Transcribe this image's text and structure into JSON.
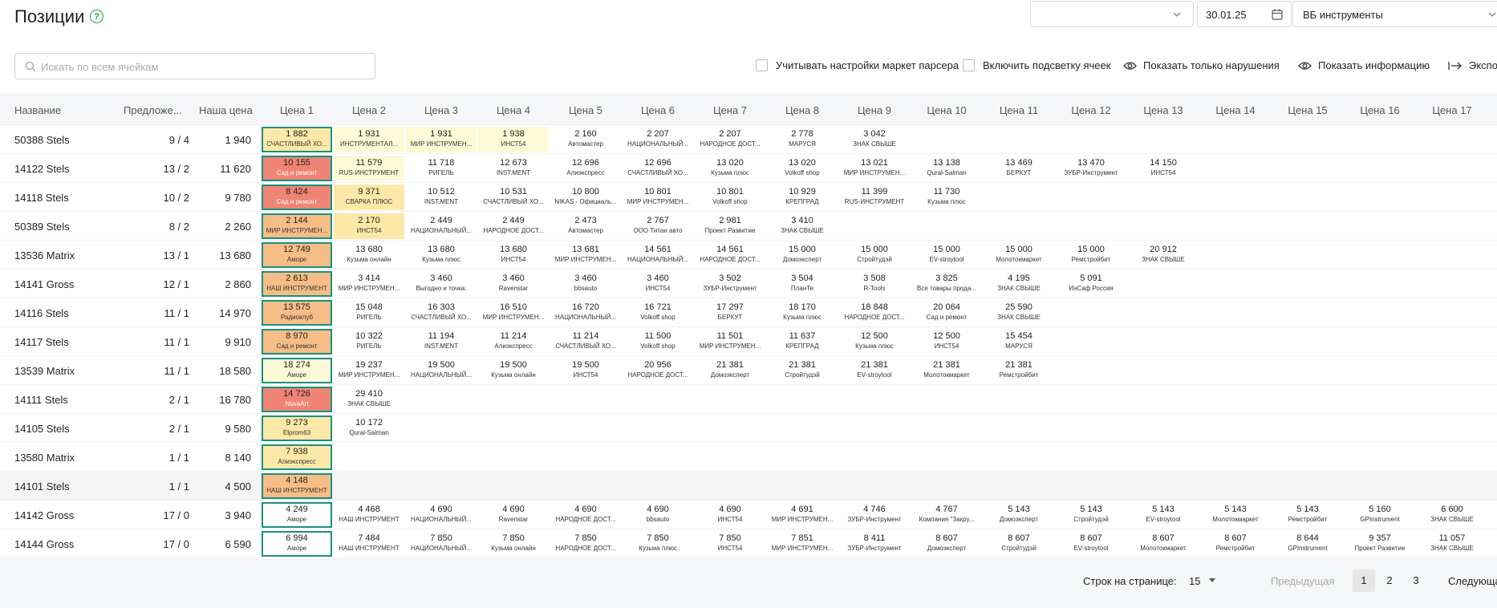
{
  "header": {
    "title": "Позиции",
    "help_icon": "question-circle-icon",
    "filter1_value": "",
    "date": "30.01.25",
    "marketplace": "ВБ инструменты"
  },
  "search": {
    "placeholder": "Искать по всем ячейкам",
    "value": ""
  },
  "options": {
    "parser_settings": "Учитывать настройки маркет парсера",
    "highlight_cells": "Включить подсветку ячеек",
    "only_violations": "Показать только нарушения",
    "show_info": "Показать информацию",
    "export": "Экспо"
  },
  "columns": {
    "name": "Название",
    "offers": "Предложе...",
    "our_price": "Наша цена",
    "prices": [
      "Цена 1",
      "Цена 2",
      "Цена 3",
      "Цена 4",
      "Цена 5",
      "Цена 6",
      "Цена 7",
      "Цена 8",
      "Цена 9",
      "Цена 10",
      "Цена 11",
      "Цена 12",
      "Цена 13",
      "Цена 14",
      "Цена 15",
      "Цена 16",
      "Цена 17"
    ]
  },
  "rows": [
    {
      "name": "50388 Stels",
      "offers": "9 / 4",
      "ours": "1 940",
      "prices": [
        [
          "1 882",
          "СЧАСТЛИВЫЙ ХО...",
          "yellow"
        ],
        [
          "1 931",
          "ИНСТРУМЕНТАЛ...",
          "lyellow"
        ],
        [
          "1 931",
          "МИР ИНСТРУМЕН...",
          "lyellow"
        ],
        [
          "1 938",
          "ИНСТ54",
          "lyellow"
        ],
        [
          "2 160",
          "Автомастер",
          ""
        ],
        [
          "2 207",
          "НАЦИОНАЛЬНЫЙ...",
          ""
        ],
        [
          "2 207",
          "НАРОДНОЕ ДОСТ...",
          ""
        ],
        [
          "2 778",
          "МАРУСЯ",
          ""
        ],
        [
          "3 042",
          "ЗНАК СВЫШЕ",
          ""
        ]
      ]
    },
    {
      "name": "14122 Stels",
      "offers": "13 / 2",
      "ours": "11 620",
      "prices": [
        [
          "10 155",
          "Сад и ремонт",
          "red"
        ],
        [
          "11 579",
          "RUS-ИНСТРУМЕНТ",
          "lyellow"
        ],
        [
          "11 718",
          "РИГЕЛЬ",
          ""
        ],
        [
          "12 673",
          "INST.MENT",
          ""
        ],
        [
          "12 696",
          "Алиэкспресс",
          ""
        ],
        [
          "12 696",
          "СЧАСТЛИВЫЙ ХО...",
          ""
        ],
        [
          "13 020",
          "Кузьма плюс",
          ""
        ],
        [
          "13 020",
          "Volkoff shop",
          ""
        ],
        [
          "13 021",
          "МИР ИНСТРУМЕН...",
          ""
        ],
        [
          "13 138",
          "Qural-Salman",
          ""
        ],
        [
          "13 469",
          "БЕРКУТ",
          ""
        ],
        [
          "13 470",
          "ЗУБР-Инструмент",
          ""
        ],
        [
          "14 150",
          "ИНСТ54",
          ""
        ]
      ]
    },
    {
      "name": "14118 Stels",
      "offers": "10 / 2",
      "ours": "9 780",
      "prices": [
        [
          "8 424",
          "Сад и ремонт",
          "red"
        ],
        [
          "9 371",
          "СВАРКА ПЛЮС",
          "yellow"
        ],
        [
          "10 512",
          "INST.MENT",
          ""
        ],
        [
          "10 531",
          "СЧАСТЛИВЫЙ ХО...",
          ""
        ],
        [
          "10 800",
          "NIKAS - Официаль...",
          ""
        ],
        [
          "10 801",
          "МИР ИНСТРУМЕН...",
          ""
        ],
        [
          "10 801",
          "Volkoff shop",
          ""
        ],
        [
          "10 929",
          "КРЕПГРАД",
          ""
        ],
        [
          "11 399",
          "RUS-ИНСТРУМЕНТ",
          ""
        ],
        [
          "11 730",
          "Кузьма плюс",
          ""
        ]
      ]
    },
    {
      "name": "50389 Stels",
      "offers": "8 / 2",
      "ours": "2 260",
      "prices": [
        [
          "2 144",
          "МИР ИНСТРУМЕН...",
          "orange"
        ],
        [
          "2 170",
          "ИНСТ54",
          "yellow"
        ],
        [
          "2 449",
          "НАЦИОНАЛЬНЫЙ...",
          ""
        ],
        [
          "2 449",
          "НАРОДНОЕ ДОСТ...",
          ""
        ],
        [
          "2 473",
          "Автомастер",
          ""
        ],
        [
          "2 767",
          "ООО Титан авто",
          ""
        ],
        [
          "2 981",
          "Проект Развитие",
          ""
        ],
        [
          "3 410",
          "ЗНАК СВЫШЕ",
          ""
        ]
      ]
    },
    {
      "name": "13536 Matrix",
      "offers": "13 / 1",
      "ours": "13 680",
      "prices": [
        [
          "12 749",
          "Аморе",
          "orange"
        ],
        [
          "13 680",
          "Кузьма онлайн",
          ""
        ],
        [
          "13 680",
          "Кузьма плюс",
          ""
        ],
        [
          "13 680",
          "ИНСТ54",
          ""
        ],
        [
          "13 681",
          "МИР ИНСТРУМЕН...",
          ""
        ],
        [
          "14 561",
          "НАЦИОНАЛЬНЫЙ...",
          ""
        ],
        [
          "14 561",
          "НАРОДНОЕ ДОСТ...",
          ""
        ],
        [
          "15 000",
          "Домоэксперт",
          ""
        ],
        [
          "15 000",
          "Стройтудэй",
          ""
        ],
        [
          "15 000",
          "EV-stroytool",
          ""
        ],
        [
          "15 000",
          "Молотокмаркет",
          ""
        ],
        [
          "15 000",
          "Ремстройбит",
          ""
        ],
        [
          "20 912",
          "ЗНАК СВЫШЕ",
          ""
        ]
      ]
    },
    {
      "name": "14141 Gross",
      "offers": "12 / 1",
      "ours": "2 860",
      "prices": [
        [
          "2 613",
          "НАШ ИНСТРУМЕНТ",
          "orange"
        ],
        [
          "3 414",
          "МИР ИНСТРУМЕН...",
          ""
        ],
        [
          "3 460",
          "Выгодно и точка.",
          ""
        ],
        [
          "3 460",
          "Ravenstar",
          ""
        ],
        [
          "3 460",
          "bbsauto",
          ""
        ],
        [
          "3 460",
          "ИНСТ54",
          ""
        ],
        [
          "3 502",
          "ЗУБР-Инструмент",
          ""
        ],
        [
          "3 504",
          "ПланТе",
          ""
        ],
        [
          "3 508",
          "R-Tools",
          ""
        ],
        [
          "3 825",
          "Все товары прода...",
          ""
        ],
        [
          "4 195",
          "ЗНАК СВЫШЕ",
          ""
        ],
        [
          "5 091",
          "ИнСаф Россия",
          ""
        ]
      ]
    },
    {
      "name": "14116 Stels",
      "offers": "11 / 1",
      "ours": "14 970",
      "prices": [
        [
          "13 575",
          "Радиоклуб",
          "orange"
        ],
        [
          "15 048",
          "РИГЕЛЬ",
          ""
        ],
        [
          "16 303",
          "СЧАСТЛИВЫЙ ХО...",
          ""
        ],
        [
          "16 510",
          "МИР ИНСТРУМЕН...",
          ""
        ],
        [
          "16 720",
          "НАЦИОНАЛЬНЫЙ...",
          ""
        ],
        [
          "16 721",
          "Volkoff shop",
          ""
        ],
        [
          "17 297",
          "БЕРКУТ",
          ""
        ],
        [
          "18 170",
          "Кузьма плюс",
          ""
        ],
        [
          "18 848",
          "НАРОДНОЕ ДОСТ...",
          ""
        ],
        [
          "20 064",
          "Сад и ремонт",
          ""
        ],
        [
          "25 590",
          "ЗНАК СВЫШЕ",
          ""
        ]
      ]
    },
    {
      "name": "14117 Stels",
      "offers": "11 / 1",
      "ours": "9 910",
      "prices": [
        [
          "8 970",
          "Сад и ремонт",
          "orange"
        ],
        [
          "10 322",
          "РИГЕЛЬ",
          ""
        ],
        [
          "11 194",
          "INST.MENT",
          ""
        ],
        [
          "11 214",
          "Алиэкспресс",
          ""
        ],
        [
          "11 214",
          "СЧАСТЛИВЫЙ ХО...",
          ""
        ],
        [
          "11 500",
          "Volkoff shop",
          ""
        ],
        [
          "11 501",
          "МИР ИНСТРУМЕН...",
          ""
        ],
        [
          "11 637",
          "КРЕПГРАД",
          ""
        ],
        [
          "12 500",
          "Кузьма плюс",
          ""
        ],
        [
          "12 500",
          "ИНСТ54",
          ""
        ],
        [
          "15 454",
          "МАРУСЯ",
          ""
        ]
      ]
    },
    {
      "name": "13539 Matrix",
      "offers": "11 / 1",
      "ours": "18 580",
      "prices": [
        [
          "18 274",
          "Аморе",
          "lyellow"
        ],
        [
          "19 237",
          "МИР ИНСТРУМЕН...",
          ""
        ],
        [
          "19 500",
          "НАЦИОНАЛЬНЫЙ...",
          ""
        ],
        [
          "19 500",
          "Кузьма онлайн",
          ""
        ],
        [
          "19 500",
          "ИНСТ54",
          ""
        ],
        [
          "20 956",
          "НАРОДНОЕ ДОСТ...",
          ""
        ],
        [
          "21 381",
          "Домоэксперт",
          ""
        ],
        [
          "21 381",
          "Стройтудэй",
          ""
        ],
        [
          "21 381",
          "EV-stroytool",
          ""
        ],
        [
          "21 381",
          "Молотокмаркет",
          ""
        ],
        [
          "21 381",
          "Ремстройбит",
          ""
        ]
      ]
    },
    {
      "name": "14111 Stels",
      "offers": "2 / 1",
      "ours": "16 780",
      "prices": [
        [
          "14 726",
          "NovaArt",
          "red"
        ],
        [
          "29 410",
          "ЗНАК СВЫШЕ",
          ""
        ]
      ]
    },
    {
      "name": "14105 Stels",
      "offers": "2 / 1",
      "ours": "9 580",
      "prices": [
        [
          "9 273",
          "Elprom63",
          "yellow"
        ],
        [
          "10 172",
          "Qural-Salman",
          ""
        ]
      ]
    },
    {
      "name": "13580 Matrix",
      "offers": "1 / 1",
      "ours": "8 140",
      "prices": [
        [
          "7 938",
          "Алиэкспресс",
          "yellow"
        ]
      ]
    },
    {
      "name": "14101 Stels",
      "offers": "1 / 1",
      "ours": "4 500",
      "prices": [
        [
          "4 148",
          "НАШ ИНСТРУМЕНТ",
          "orange"
        ]
      ]
    },
    {
      "name": "14142 Gross",
      "offers": "17 / 0",
      "ours": "3 940",
      "prices": [
        [
          "4 249",
          "Аморе",
          "white"
        ],
        [
          "4 468",
          "НАШ ИНСТРУМЕНТ",
          ""
        ],
        [
          "4 690",
          "НАЦИОНАЛЬНЫЙ...",
          ""
        ],
        [
          "4 690",
          "Ravenstar",
          ""
        ],
        [
          "4 690",
          "НАРОДНОЕ ДОСТ...",
          ""
        ],
        [
          "4 690",
          "bbsauto",
          ""
        ],
        [
          "4 690",
          "ИНСТ54",
          ""
        ],
        [
          "4 691",
          "МИР ИНСТРУМЕН...",
          ""
        ],
        [
          "4 746",
          "ЗУБР-Инструмент",
          ""
        ],
        [
          "4 767",
          "Компания \"Закру...",
          ""
        ],
        [
          "5 143",
          "Домоэксперт",
          ""
        ],
        [
          "5 143",
          "Стройтудэй",
          ""
        ],
        [
          "5 143",
          "EV-stroytool",
          ""
        ],
        [
          "5 143",
          "Молотокмаркет",
          ""
        ],
        [
          "5 143",
          "Ремстройбит",
          ""
        ],
        [
          "5 160",
          "GPInstrument",
          ""
        ],
        [
          "6 600",
          "ЗНАК СВЫШЕ",
          ""
        ]
      ]
    },
    {
      "name": "14144 Gross",
      "offers": "17 / 0",
      "ours": "6 590",
      "prices": [
        [
          "6 994",
          "Аморе",
          "white"
        ],
        [
          "7 484",
          "НАШ ИНСТРУМЕНТ",
          ""
        ],
        [
          "7 850",
          "НАЦИОНАЛЬНЫЙ...",
          ""
        ],
        [
          "7 850",
          "Кузьма онлайн",
          ""
        ],
        [
          "7 850",
          "НАРОДНОЕ ДОСТ...",
          ""
        ],
        [
          "7 850",
          "Кузьма плюс",
          ""
        ],
        [
          "7 850",
          "ИНСТ54",
          ""
        ],
        [
          "7 851",
          "МИР ИНСТРУМЕН...",
          ""
        ],
        [
          "8 411",
          "ЗУБР-Инструмент",
          ""
        ],
        [
          "8 607",
          "Домоэксперт",
          ""
        ],
        [
          "8 607",
          "Стройтудэй",
          ""
        ],
        [
          "8 607",
          "EV-stroytool",
          ""
        ],
        [
          "8 607",
          "Молотокмаркет",
          ""
        ],
        [
          "8 607",
          "Ремстройбит",
          ""
        ],
        [
          "8 644",
          "GPInstrument",
          ""
        ],
        [
          "9 357",
          "Проект Развитие",
          ""
        ],
        [
          "11 057",
          "ЗНАК СВЫШЕ",
          ""
        ]
      ]
    }
  ],
  "pagination": {
    "rows_label": "Строк на странице:",
    "rows_value": "15",
    "prev": "Предыдущая",
    "pages": [
      "1",
      "2",
      "3"
    ],
    "next": "Следующа"
  }
}
